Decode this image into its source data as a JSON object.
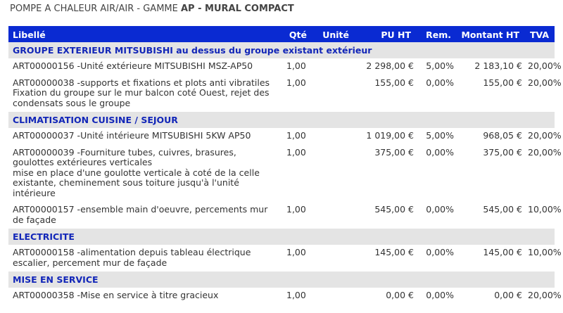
{
  "document_title": {
    "prefix": "POMPE A CHALEUR AIR/AIR - GAMME ",
    "emphasis": "AP - MURAL COMPACT"
  },
  "table": {
    "headers": {
      "label": "Libellé",
      "qty": "Qté",
      "unit": "Unité",
      "unit_price": "PU HT",
      "discount": "Rem.",
      "amount": "Montant HT",
      "vat": "TVA"
    },
    "sections": [
      {
        "title": "GROUPE EXTERIEUR MITSUBISHI au dessus du groupe existant extérieur",
        "items": [
          {
            "label_lines": [
              "ART00000156 -Unité extérieure MITSUBISHI MSZ-AP50"
            ],
            "qty": "1,00",
            "unit": "",
            "unit_price": "2 298,00 €",
            "discount": "5,00%",
            "amount": "2 183,10 €",
            "vat": "20,00%"
          },
          {
            "label_lines": [
              "ART00000038 -supports et fixations et plots anti vibratiles",
              "Fixation du groupe sur le mur balcon coté Ouest, rejet des",
              "condensats sous le groupe"
            ],
            "qty": "1,00",
            "unit": "",
            "unit_price": "155,00 €",
            "discount": "0,00%",
            "amount": "155,00 €",
            "vat": "20,00%"
          }
        ]
      },
      {
        "title": "CLIMATISATION CUISINE / SEJOUR",
        "items": [
          {
            "label_lines": [
              "ART00000037 -Unité intérieure MITSUBISHI 5KW AP50"
            ],
            "qty": "1,00",
            "unit": "",
            "unit_price": "1 019,00 €",
            "discount": "5,00%",
            "amount": "968,05 €",
            "vat": "20,00%"
          },
          {
            "label_lines": [
              "ART00000039 -Fourniture tubes, cuivres, brasures,",
              "goulottes extérieures verticales",
              "mise en place d'une goulotte verticale à coté de la celle",
              "existante, cheminement sous toiture jusqu'à l'unité",
              "intérieure"
            ],
            "qty": "1,00",
            "unit": "",
            "unit_price": "375,00 €",
            "discount": "0,00%",
            "amount": "375,00 €",
            "vat": "20,00%"
          },
          {
            "label_lines": [
              "ART00000157 -ensemble main d'oeuvre, percements mur",
              "de façade"
            ],
            "qty": "1,00",
            "unit": "",
            "unit_price": "545,00 €",
            "discount": "0,00%",
            "amount": "545,00 €",
            "vat": "10,00%"
          }
        ]
      },
      {
        "title": "ELECTRICITE",
        "items": [
          {
            "label_lines": [
              "ART00000158 -alimentation depuis tableau électrique",
              "escalier, percement mur de façade"
            ],
            "qty": "1,00",
            "unit": "",
            "unit_price": "145,00 €",
            "discount": "0,00%",
            "amount": "145,00 €",
            "vat": "10,00%"
          }
        ]
      },
      {
        "title": "MISE EN SERVICE",
        "items": [
          {
            "label_lines": [
              "ART00000358 -Mise en service à titre gracieux"
            ],
            "qty": "1,00",
            "unit": "",
            "unit_price": "0,00 €",
            "discount": "0,00%",
            "amount": "0,00 €",
            "vat": "20,00%"
          }
        ]
      }
    ]
  },
  "colors": {
    "header_background": "#0a2ad2",
    "header_text": "#ffffff",
    "section_background": "#e4e4e4",
    "section_text": "#1226b8",
    "body_text": "#333333"
  }
}
